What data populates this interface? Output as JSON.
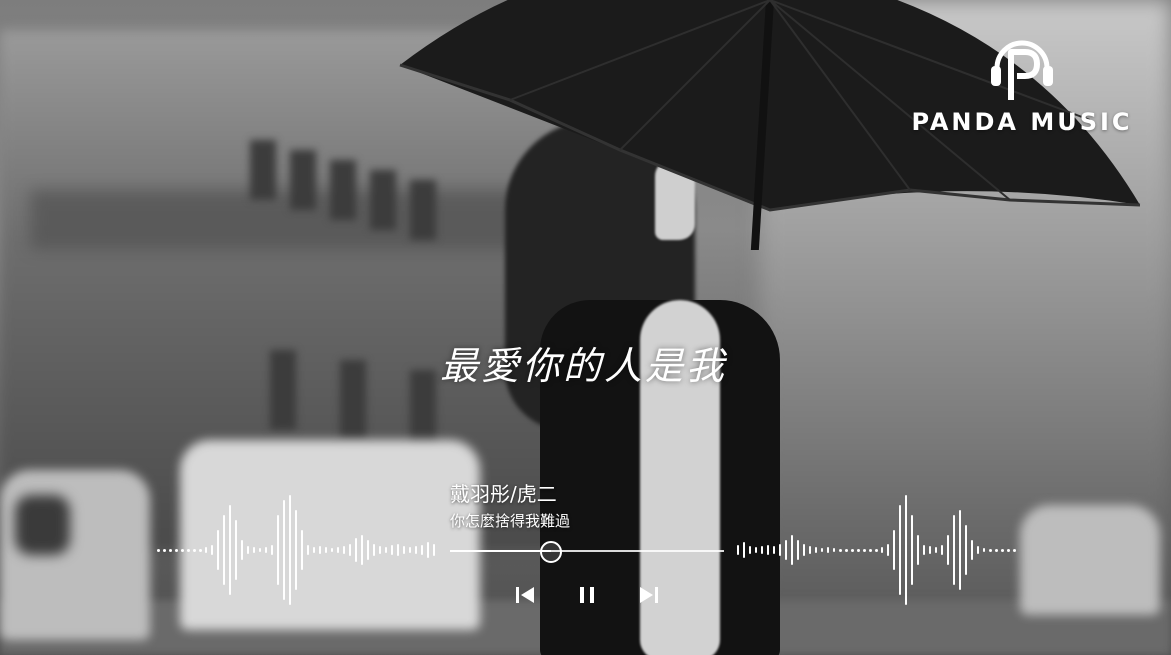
{
  "brand": {
    "name": "PANDA MUSIC",
    "logo_icon": "headphones-p-icon"
  },
  "now_playing": {
    "title": "最愛你的人是我",
    "artist": "戴羽彤/虎二",
    "lyric_line": "你怎麼捨得我難過",
    "progress": 0.37
  },
  "controls": {
    "previous_icon": "skip-previous-icon",
    "pause_icon": "pause-icon",
    "next_icon": "skip-next-icon"
  },
  "colors": {
    "foreground": "#ffffff",
    "background_tone": "grayscale"
  }
}
